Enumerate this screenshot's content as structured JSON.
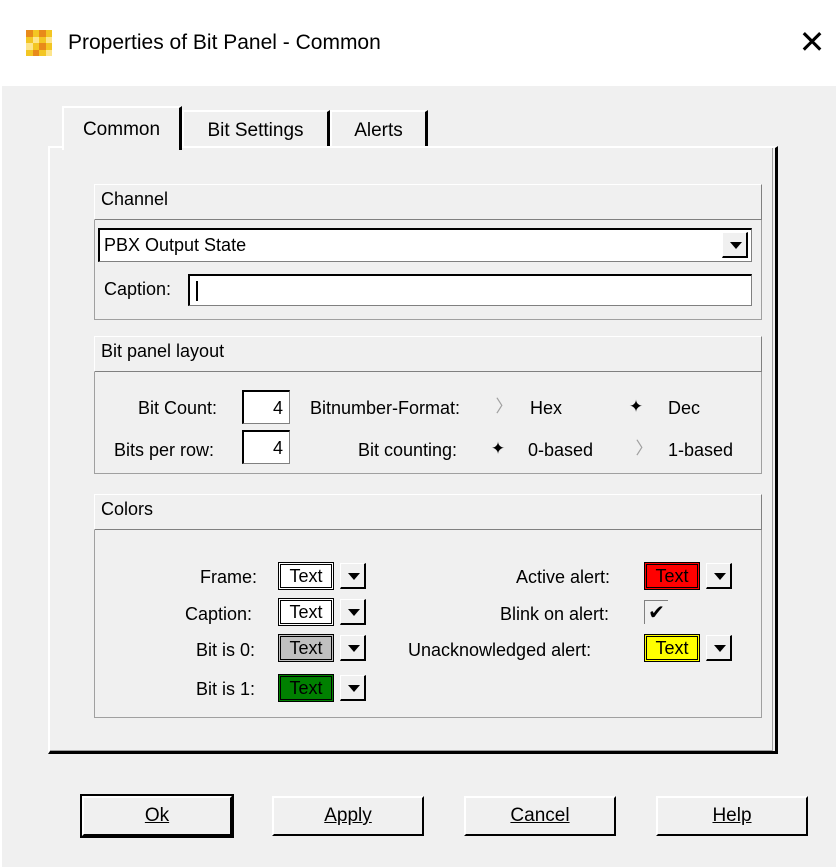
{
  "window": {
    "title": "Properties of Bit Panel - Common",
    "close_glyph": "✕",
    "icon": "app-icon"
  },
  "tabs": [
    {
      "label": "Common",
      "active": true
    },
    {
      "label": "Bit Settings",
      "active": false
    },
    {
      "label": "Alerts",
      "active": false
    }
  ],
  "channel": {
    "group_label": "Channel",
    "selected": "PBX Output State",
    "caption_label": "Caption:",
    "caption_value": ""
  },
  "layout": {
    "group_label": "Bit panel layout",
    "bit_count_label": "Bit Count:",
    "bit_count": "4",
    "bits_per_row_label": "Bits per row:",
    "bits_per_row": "4",
    "format_label": "Bitnumber-Format:",
    "format_options": [
      "Hex",
      "Dec"
    ],
    "format_selected": "Dec",
    "counting_label": "Bit counting:",
    "counting_options": [
      "0-based",
      "1-based"
    ],
    "counting_selected": "0-based"
  },
  "colors": {
    "group_label": "Colors",
    "frame_label": "Frame:",
    "caption_label": "Caption:",
    "bit0_label": "Bit is 0:",
    "bit1_label": "Bit is 1:",
    "active_alert_label": "Active alert:",
    "blink_label": "Blink on alert:",
    "unack_label": "Unacknowledged alert:",
    "swatch_text": "Text",
    "blink_checked": "✔",
    "frame_color": "#ffffff",
    "caption_color": "#ffffff",
    "bit0_color": "#c0c0c0",
    "bit1_color": "#008000",
    "active_alert_color": "#ff0000",
    "unack_color": "#ffff00"
  },
  "buttons": {
    "ok": "Ok",
    "apply": "Apply",
    "cancel": "Cancel",
    "help": "Help"
  }
}
